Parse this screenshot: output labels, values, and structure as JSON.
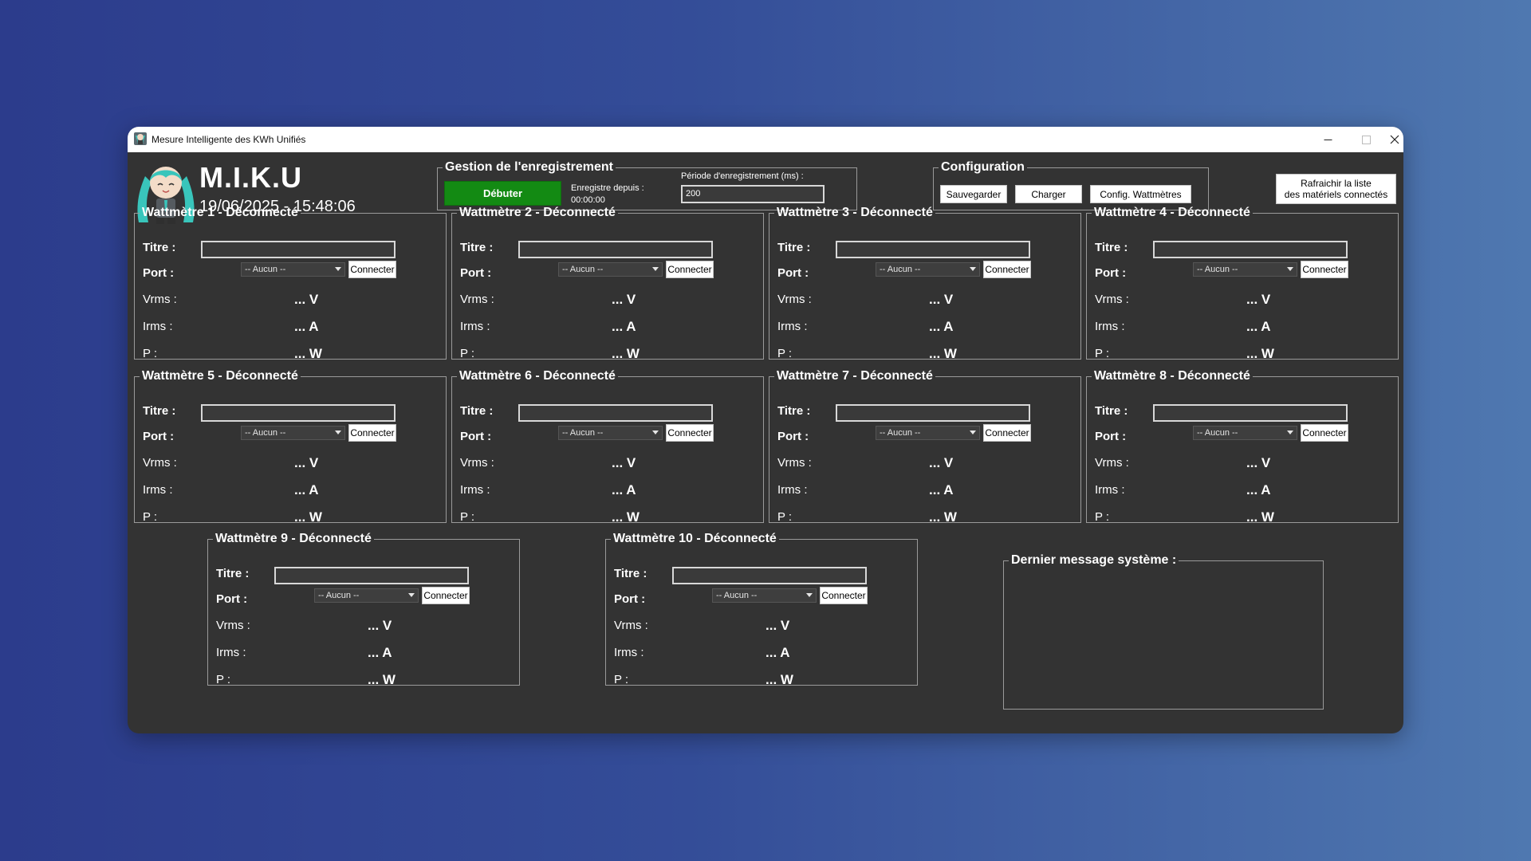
{
  "window": {
    "title": "Mesure Intelligente des KWh Unifiés",
    "controls": {
      "minimize": "–",
      "maximize": "☐",
      "close": "✕"
    }
  },
  "header": {
    "app_name": "M.I.K.U",
    "datetime": "19/06/2025 - 15:48:06"
  },
  "recording": {
    "legend": "Gestion de l'enregistrement",
    "start_button": "Débuter",
    "since_label": "Enregistre depuis :",
    "since_value": "00:00:00",
    "period_label": "Période d'enregistrement (ms) :",
    "period_value": "200",
    "start_color": "#138a13"
  },
  "configuration": {
    "legend": "Configuration",
    "save_button": "Sauvegarder",
    "load_button": "Charger",
    "config_button": "Config. Wattmètres"
  },
  "refresh_button": {
    "line1": "Rafraichir la liste",
    "line2": "des matériels connectés"
  },
  "labels": {
    "titre": "Titre :",
    "port": "Port :",
    "vrms": "Vrms :",
    "irms": "Irms :",
    "p": "P :",
    "connect": "Connecter"
  },
  "wattmeters": [
    {
      "legend": "Wattmètre 1 - Déconnecté",
      "title_value": "",
      "port": "-- Aucun --",
      "vrms": "... V",
      "irms": "... A",
      "p": "... W"
    },
    {
      "legend": "Wattmètre 2 - Déconnecté",
      "title_value": "",
      "port": "-- Aucun --",
      "vrms": "... V",
      "irms": "... A",
      "p": "... W"
    },
    {
      "legend": "Wattmètre 3 - Déconnecté",
      "title_value": "",
      "port": "-- Aucun --",
      "vrms": "... V",
      "irms": "... A",
      "p": "... W"
    },
    {
      "legend": "Wattmètre 4 - Déconnecté",
      "title_value": "",
      "port": "-- Aucun --",
      "vrms": "... V",
      "irms": "... A",
      "p": "... W"
    },
    {
      "legend": "Wattmètre 5 - Déconnecté",
      "title_value": "",
      "port": "-- Aucun --",
      "vrms": "... V",
      "irms": "... A",
      "p": "... W"
    },
    {
      "legend": "Wattmètre 6 - Déconnecté",
      "title_value": "",
      "port": "-- Aucun --",
      "vrms": "... V",
      "irms": "... A",
      "p": "... W"
    },
    {
      "legend": "Wattmètre 7 - Déconnecté",
      "title_value": "",
      "port": "-- Aucun --",
      "vrms": "... V",
      "irms": "... A",
      "p": "... W"
    },
    {
      "legend": "Wattmètre 8 - Déconnecté",
      "title_value": "",
      "port": "-- Aucun --",
      "vrms": "... V",
      "irms": "... A",
      "p": "... W"
    },
    {
      "legend": "Wattmètre 9 - Déconnecté",
      "title_value": "",
      "port": "-- Aucun --",
      "vrms": "... V",
      "irms": "... A",
      "p": "... W"
    },
    {
      "legend": "Wattmètre 10 - Déconnecté",
      "title_value": "",
      "port": "-- Aucun --",
      "vrms": "... V",
      "irms": "... A",
      "p": "... W"
    }
  ],
  "system_message": {
    "legend": "Dernier message système :",
    "text": ""
  },
  "icons": {
    "app_icon": "miku-app-icon",
    "logo": "miku-chibi-logo",
    "dropdown": "chevron-down-icon"
  }
}
